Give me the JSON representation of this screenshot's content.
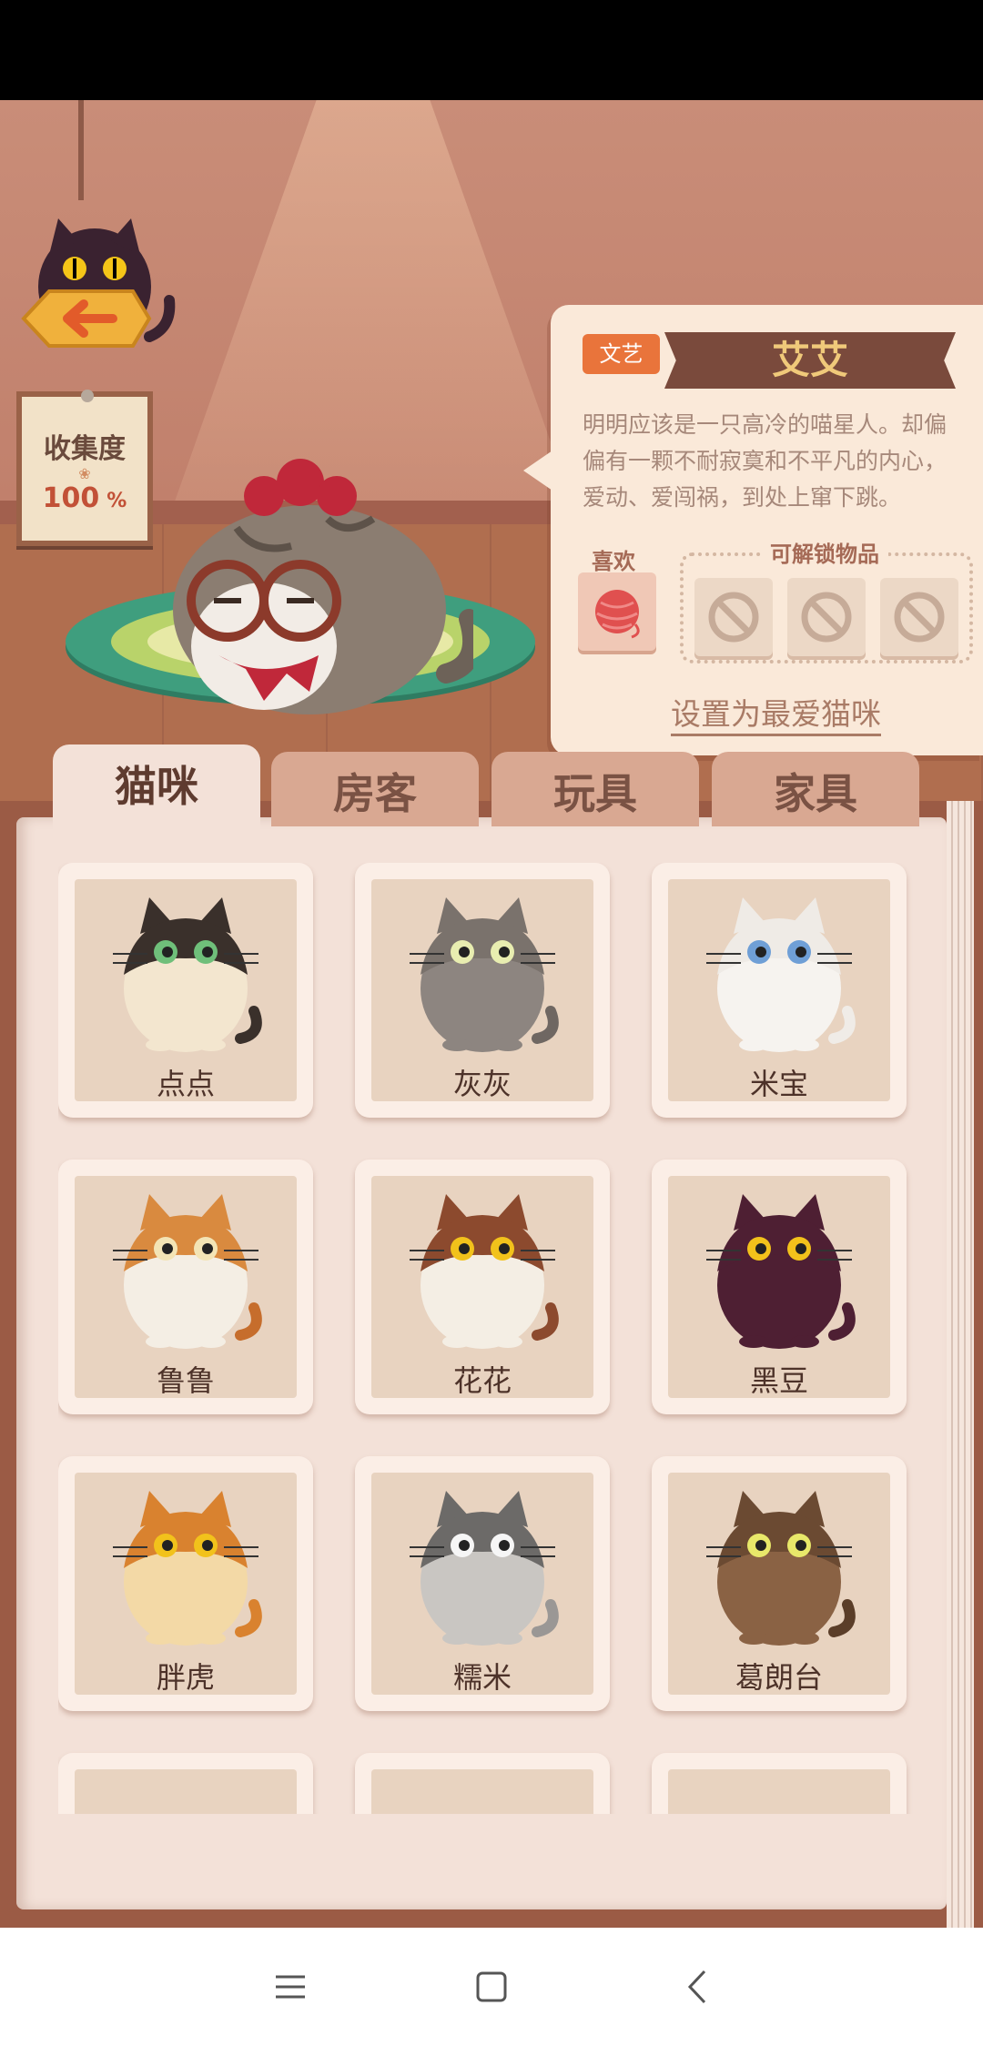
{
  "collection": {
    "title": "收集度",
    "value": "100",
    "unit": "%"
  },
  "featured_cat": {
    "tag": "文艺",
    "name": "艾艾",
    "description": "明明应该是一只高冷的喵星人。却偏偏有一颗不耐寂寞和不平凡的内心，爱动、爱闯祸，到处上窜下跳。",
    "likes_label": "喜欢",
    "likes_item_icon": "yarn-ball-icon",
    "unlock_label": "可解锁物品",
    "unlock_slots": [
      "locked-icon",
      "locked-icon",
      "locked-icon"
    ],
    "set_favorite_label": "设置为最爱猫咪"
  },
  "tabs": [
    {
      "label": "猫咪",
      "active": true
    },
    {
      "label": "房客",
      "active": false
    },
    {
      "label": "玩具",
      "active": false
    },
    {
      "label": "家具",
      "active": false
    }
  ],
  "cats": [
    {
      "name": "点点"
    },
    {
      "name": "灰灰"
    },
    {
      "name": "米宝"
    },
    {
      "name": "鲁鲁"
    },
    {
      "name": "花花"
    },
    {
      "name": "黑豆"
    },
    {
      "name": "胖虎"
    },
    {
      "name": "糯米"
    },
    {
      "name": "葛朗台"
    }
  ],
  "colors": {
    "accent": "#e9743b",
    "banner": "#7a4a3c",
    "page": "#f3e1d8"
  }
}
